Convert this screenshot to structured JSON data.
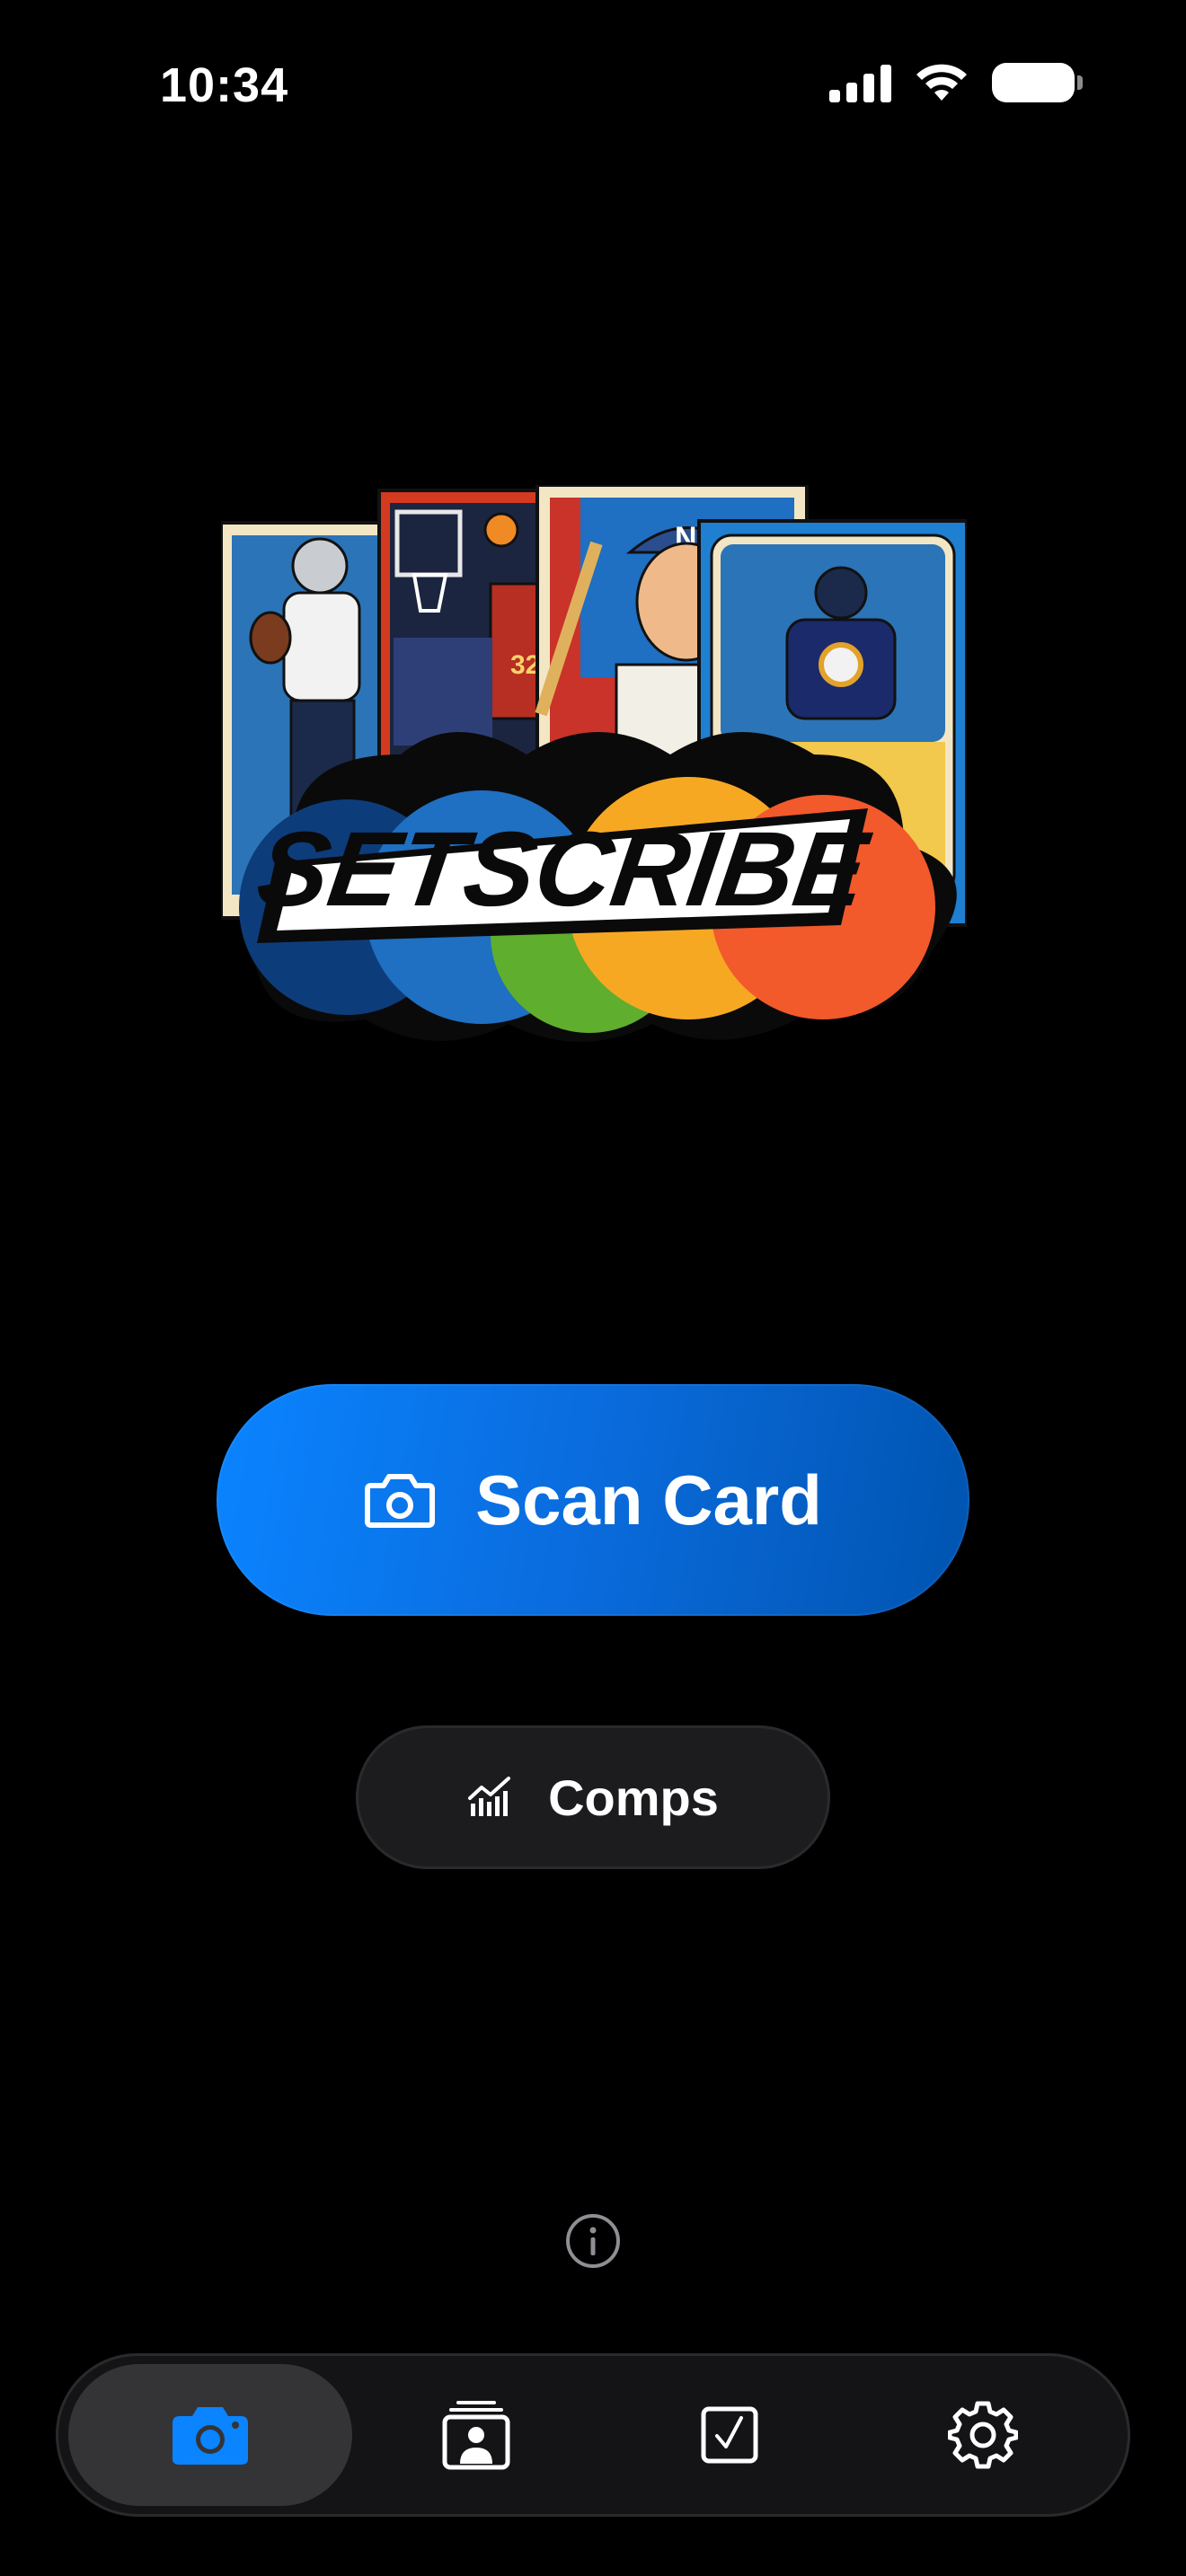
{
  "status_bar": {
    "time": "10:34"
  },
  "logo": {
    "wordmark": "SETSCRIBE",
    "card_number": "32",
    "cap_letter": "N"
  },
  "actions": {
    "scan_label": "Scan Card",
    "comps_label": "Comps"
  },
  "tabbar": {
    "tabs": [
      {
        "icon": "camera-icon",
        "active": true
      },
      {
        "icon": "collection-icon",
        "active": false
      },
      {
        "icon": "checklist-icon",
        "active": false
      },
      {
        "icon": "gear-icon",
        "active": false
      }
    ]
  },
  "colors": {
    "accent": "#0a84ff",
    "background": "#000000",
    "active_tab_bg": "#343436",
    "logo_cloud": [
      "#0d3c7a",
      "#1f6fc2",
      "#5fae2e",
      "#f7a823",
      "#f2592b"
    ]
  }
}
